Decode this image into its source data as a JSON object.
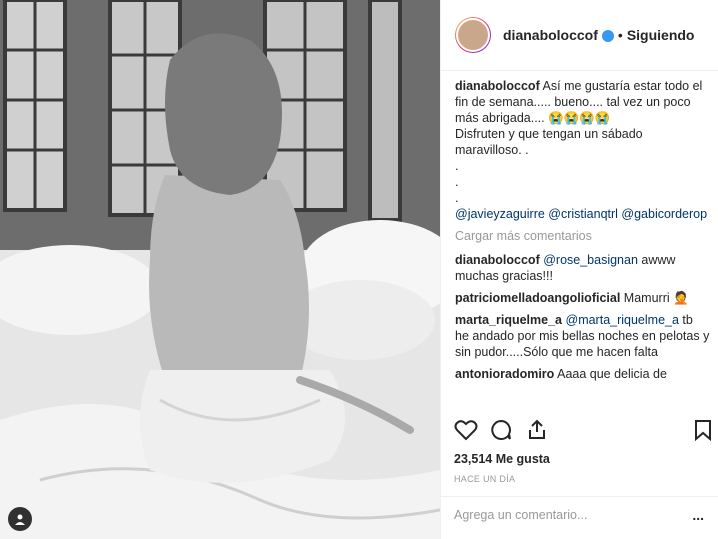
{
  "header": {
    "username": "dianabolocсof",
    "separator": "•",
    "follow_status": "Siguiendo"
  },
  "caption": {
    "username": "dianabolocсof",
    "lines": [
      "Así me gustaría estar todo el fin de semana..... bueno.... tal vez un poco más abrigada.... 😭😭😭😭",
      "Disfruten y que tengan un sábado maravilloso. .",
      ".",
      ".",
      "."
    ],
    "mentions": "@javieyzaguirre @cristianqtrl @gabicorderop"
  },
  "load_more": "Cargar más comentarios",
  "comments": [
    {
      "user": "dianabolocсof",
      "mention": "@rose_basignan",
      "text": " awww muchas gracias!!!"
    },
    {
      "user": "patriciomelladoangolioficial",
      "mention": "",
      "text": " Mamurri 🤦"
    },
    {
      "user": "marta_riquelme_a",
      "mention": "@marta_riquelme_a",
      "text": " tb he andado por mis bellas noches en pelotas y sin pudor.....Sólo que me hacen falta"
    },
    {
      "user": "antonioradomiro",
      "mention": "",
      "text": " Aaaa que delicia de"
    }
  ],
  "likes": "23,514 Me gusta",
  "timestamp": "HACE UN DÍA",
  "add_comment_placeholder": "Agrega un comentario...",
  "more_options": "...",
  "icons": [
    "heart-icon",
    "comment-icon",
    "share-icon",
    "bookmark-icon",
    "tag-user-icon",
    "verified-badge-icon"
  ]
}
